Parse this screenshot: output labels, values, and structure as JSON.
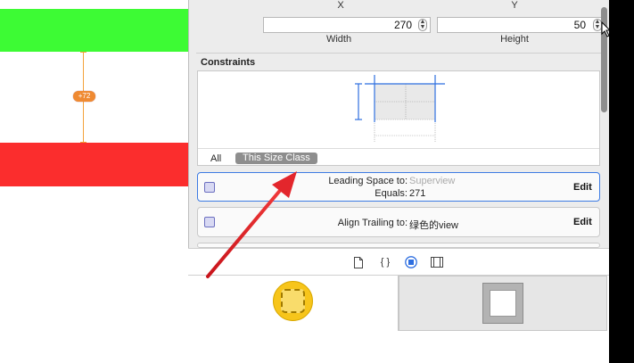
{
  "size": {
    "x_label": "X",
    "y_label": "Y",
    "width_value": "270",
    "height_value": "50",
    "width_label": "Width",
    "height_label": "Height"
  },
  "canvas": {
    "spacing_badge": "+72"
  },
  "constraints": {
    "title": "Constraints",
    "size_class_all": "All",
    "size_class_this": "This Size Class",
    "rows": [
      {
        "line1_label": "Leading Space to:",
        "line1_value": "Superview",
        "line2_label": "Equals:",
        "line2_value": "271",
        "edit": "Edit"
      },
      {
        "line1_label": "Align Trailing to:",
        "line1_value": "绿色的view",
        "edit": "Edit"
      }
    ]
  },
  "tabs": {
    "file_icon": "file-icon",
    "braces": "{ }",
    "object_icon": "object-library-icon",
    "media_icon": "media-library-icon"
  },
  "colors": {
    "green_view": "#3dfb34",
    "red_view": "#fb2d2d",
    "constraint_orange": "#f4a23a",
    "accent_blue": "#2f6fe0",
    "arrow_red": "#e3262c"
  }
}
